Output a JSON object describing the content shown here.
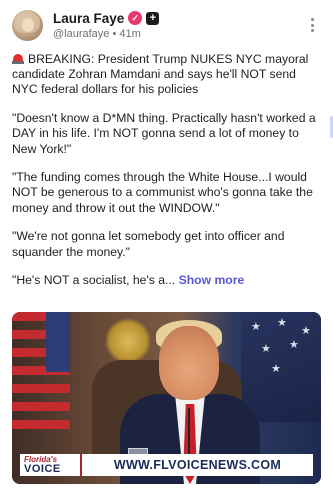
{
  "post": {
    "author": {
      "name": "Laura Faye",
      "handle": "@laurafaye",
      "separator": "•",
      "time": "41m",
      "verified_icon": "check-heart-icon",
      "extra_icon": "plus-icon"
    },
    "menu_icon": "more-vertical-icon",
    "paragraphs": [
      "BREAKING: President Trump NUKES NYC mayoral candidate Zohran Mamdani and says he'll NOT send NYC federal dollars for his policies",
      "\"Doesn't know a D*MN thing. Practically hasn't worked a DAY in his life. I'm NOT gonna send a lot of money to New York!\"",
      "\"The funding comes through the White House...I would NOT be generous to a communist who's gonna take the money and throw it out the WINDOW.\"",
      "\"We're not gonna let somebody get into officer and squander the money.\"",
      "\"He's NOT a socialist, he's a..."
    ],
    "show_more_label": "Show more",
    "siren_icon": "siren-icon",
    "media": {
      "banner_logo_top": "Florida's",
      "banner_logo_bottom": "VOICE",
      "banner_url": "WWW.FLVOICENEWS.COM"
    }
  },
  "colors": {
    "verified": "#e8386f",
    "link": "#5b56d6",
    "tie": "#c8202a"
  }
}
